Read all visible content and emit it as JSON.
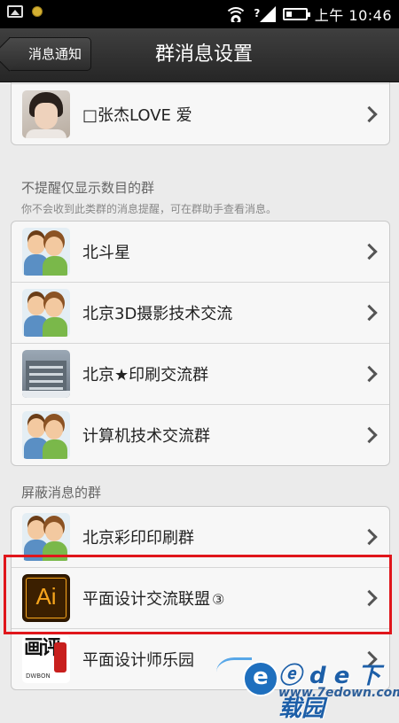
{
  "status_bar": {
    "time": "上午 10:46",
    "signal_mark": "?"
  },
  "title_bar": {
    "back_label": "消息通知",
    "title": "群消息设置"
  },
  "top_card": {
    "items": [
      {
        "name": "□张杰LOVE 爱",
        "avatar": "person-photo"
      }
    ]
  },
  "section_count_only": {
    "title": "不提醒仅显示数目的群",
    "subtitle": "你不会收到此类群的消息提醒，可在群助手查看消息。",
    "items": [
      {
        "name": "北斗星",
        "avatar": "group-couple"
      },
      {
        "name": "北京3D摄影技术交流",
        "avatar": "group-couple"
      },
      {
        "name": "北京★印刷交流群",
        "avatar": "building-photo"
      },
      {
        "name": "计算机技术交流群",
        "avatar": "group-couple"
      }
    ]
  },
  "section_blocked": {
    "title": "屏蔽消息的群",
    "items": [
      {
        "name": "北京彩印印刷群",
        "avatar": "group-couple"
      },
      {
        "name": "平面设计交流联盟",
        "badge": "③",
        "avatar": "illustrator-logo",
        "avatar_text": "Ai"
      },
      {
        "name": "平面设计师乐园",
        "avatar": "calligraphy-logo",
        "avatar_text": "画评",
        "avatar_sub": "DWBON"
      }
    ]
  },
  "watermark": {
    "text": "ⓔ d e 下载园",
    "url": "www.7edown.com"
  },
  "colors": {
    "title_bar": "#2e2e2e",
    "background": "#ebebeb",
    "highlight_border": "#e0161b",
    "ai_orange": "#f7a51c"
  }
}
